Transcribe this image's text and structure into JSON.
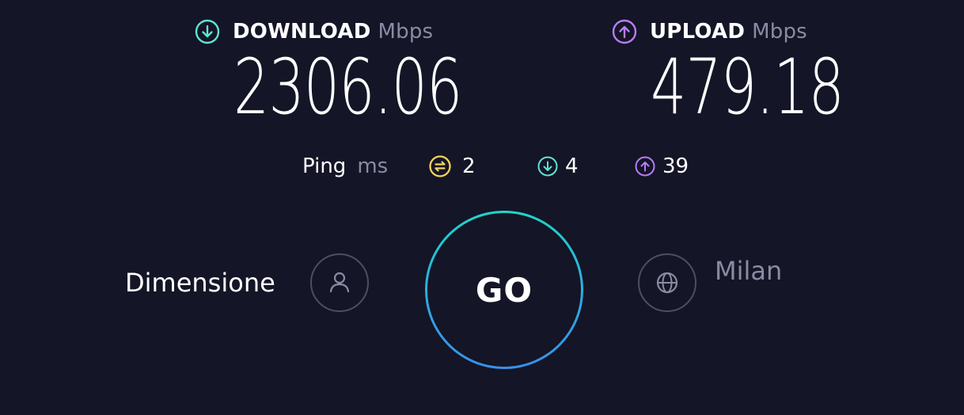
{
  "download": {
    "label": "DOWNLOAD",
    "unit": "Mbps",
    "value": "2306.06",
    "icon": "arrow-down-circle-icon",
    "color": "#5fe3d4"
  },
  "upload": {
    "label": "UPLOAD",
    "unit": "Mbps",
    "value": "479.18",
    "icon": "arrow-up-circle-icon",
    "color": "#b77cf7"
  },
  "ping": {
    "label": "Ping",
    "unit": "ms",
    "idle": {
      "value": "2",
      "icon": "jitter-icon",
      "color": "#f3d35b"
    },
    "download": {
      "value": "4",
      "icon": "arrow-down-circle-icon",
      "color": "#5fe3d4"
    },
    "upload": {
      "value": "39",
      "icon": "arrow-up-circle-icon",
      "color": "#b77cf7"
    }
  },
  "connection": {
    "provider": "Dimensione",
    "provider_icon": "user-icon",
    "server": "Milan",
    "server_icon": "globe-icon"
  },
  "go_button": {
    "label": "GO"
  }
}
